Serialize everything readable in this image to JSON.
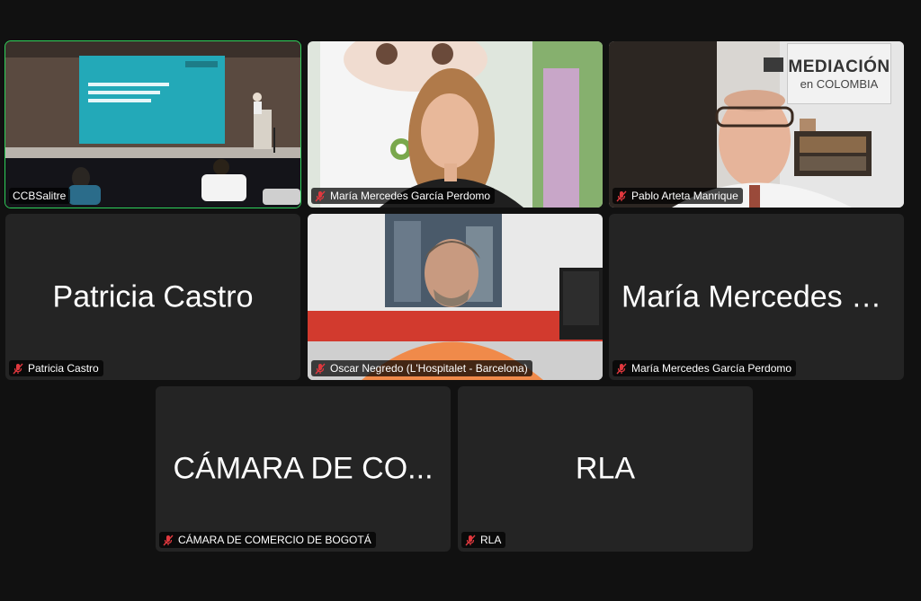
{
  "tiles": [
    {
      "name": "CCBSalitre",
      "muted": false,
      "big": ""
    },
    {
      "name": "María Mercedes García Perdomo",
      "muted": true,
      "big": ""
    },
    {
      "name": "Pablo Arteta Manrique",
      "muted": true,
      "big": ""
    },
    {
      "name": "Patricia Castro",
      "muted": true,
      "big": "Patricia Castro"
    },
    {
      "name": "Oscar Negredo (L'Hospitalet - Barcelona)",
      "muted": true,
      "big": ""
    },
    {
      "name": "María Mercedes García Perdomo",
      "muted": true,
      "big": "María Mercedes G..."
    },
    {
      "name": "CÁMARA DE COMERCIO DE BOGOTÁ",
      "muted": true,
      "big": "CÁMARA DE CO..."
    },
    {
      "name": "RLA",
      "muted": true,
      "big": "RLA"
    }
  ],
  "banner": {
    "line1": "MEDIACIÓN",
    "line2": "en COLOMBIA"
  },
  "colors": {
    "active_speaker": "#2ed15a",
    "mute": "#e0383e",
    "tile_bg": "#242424"
  },
  "icons": {
    "mute": "microphone-muted-icon"
  }
}
